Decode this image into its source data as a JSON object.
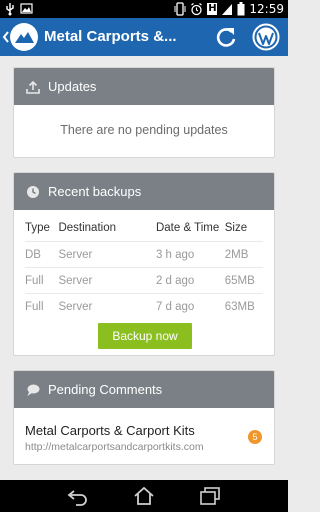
{
  "statusbar": {
    "time": "12:59",
    "h_badge": "H"
  },
  "appbar": {
    "title": "Metal Carports &...",
    "icons": [
      "back-chevron-icon",
      "mountain-logo-icon",
      "refresh-icon",
      "wordpress-icon"
    ],
    "color": "#1f66b0"
  },
  "updates": {
    "title": "Updates",
    "empty_text": "There are no pending updates"
  },
  "backups": {
    "title": "Recent backups",
    "columns": [
      "Type",
      "Destination",
      "Date & Time",
      "Size"
    ],
    "rows": [
      [
        "DB",
        "Server",
        "3 h ago",
        "2MB"
      ],
      [
        "Full",
        "Server",
        "2 d ago",
        "65MB"
      ],
      [
        "Full",
        "Server",
        "7 d ago",
        "63MB"
      ]
    ],
    "button_label": "Backup now",
    "button_color": "#8bbf20"
  },
  "comments": {
    "title": "Pending Comments",
    "site_name": "Metal Carports & Carport Kits",
    "site_url": "http://metalcarportsandcarportkits.com",
    "count": "5",
    "badge_color": "#f0962a"
  }
}
